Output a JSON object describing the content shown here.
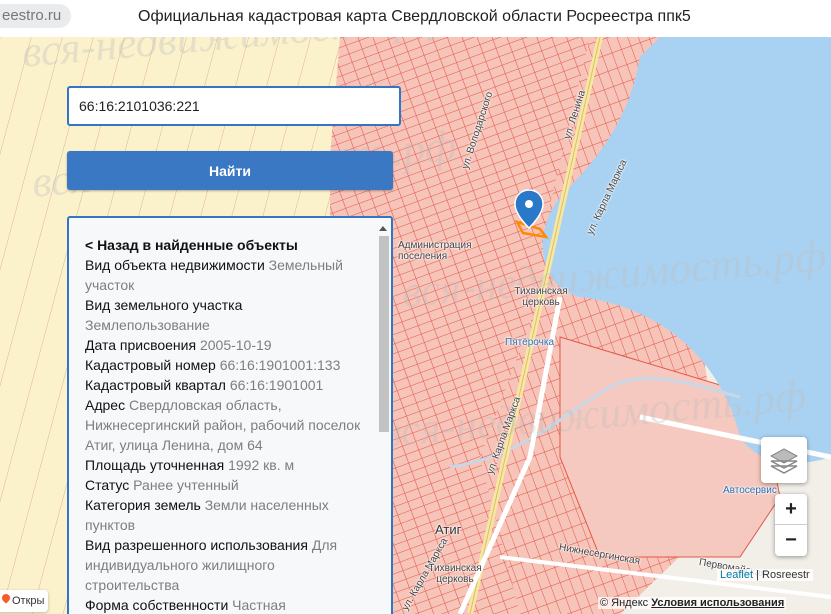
{
  "header": {
    "site": "eestro.ru",
    "title": "Официальная кадастровая карта Свердловской области Росреестра ппк5"
  },
  "search": {
    "value": "66:16:2101036:221",
    "button_label": "Найти"
  },
  "info": {
    "back_label": "< Назад в найденные объекты",
    "fields": [
      {
        "label": "Вид объекта недвижимости",
        "value": "Земельный участок"
      },
      {
        "label": "Вид земельного участка",
        "value": "Землепользование"
      },
      {
        "label": "Дата присвоения",
        "value": "2005-10-19"
      },
      {
        "label": "Кадастровый номер",
        "value": "66:16:1901001:133"
      },
      {
        "label": "Кадастровый квартал",
        "value": "66:16:1901001"
      },
      {
        "label": "Адрес",
        "value": "Свердловская область, Нижнесергинский район, рабочий поселок Атиг, улица Ленина, дом 64"
      },
      {
        "label": "Площадь уточненная",
        "value": "1992 кв. м"
      },
      {
        "label": "Статус",
        "value": "Ранее учтенный"
      },
      {
        "label": "Категория земель",
        "value": "Земли населенных пунктов"
      },
      {
        "label": "Вид разрешенного использования",
        "value": "Для индивидуального жилищного строительства"
      },
      {
        "label": "Форма собственности",
        "value": "Частная"
      }
    ]
  },
  "map": {
    "streets": {
      "volodarsky": "ул. Володарского",
      "lenina": "ул. Ленина",
      "karla_marksa_1": "ул. Карла Маркса",
      "karla_marksa_2": "ул. Карла Маркса",
      "karla_marksa_3": "ул. Карла Маркса",
      "nizhnesergin": "Нижнесергинская",
      "pervomayskaya": "Первомайская"
    },
    "pois": {
      "administration": "Администрация поселения",
      "church1": "Тихвинская церковь",
      "pyaterochka": "Пятёрочка",
      "atig": "Атиг",
      "church2": "Тихвинская церковь",
      "autoservice": "Автосервис"
    },
    "watermark": "вся-недвижимость.рф",
    "colors": {
      "water": "#a9d2f2",
      "parcel_fill": "#f6c4b8",
      "parcel_stroke": "#e4564a",
      "land": "#fbf2cc",
      "accent": "#3474c4",
      "highlight": "#ff8a00"
    }
  },
  "controls": {
    "zoom_in": "+",
    "zoom_out": "−",
    "attribution_leaflet": "Leaflet",
    "attribution_sep": " | ",
    "attribution_rosreestr": "Rosreestr",
    "yandex_copy": "© Яндекс",
    "terms": "Условия использования",
    "open_link": "Откры"
  }
}
